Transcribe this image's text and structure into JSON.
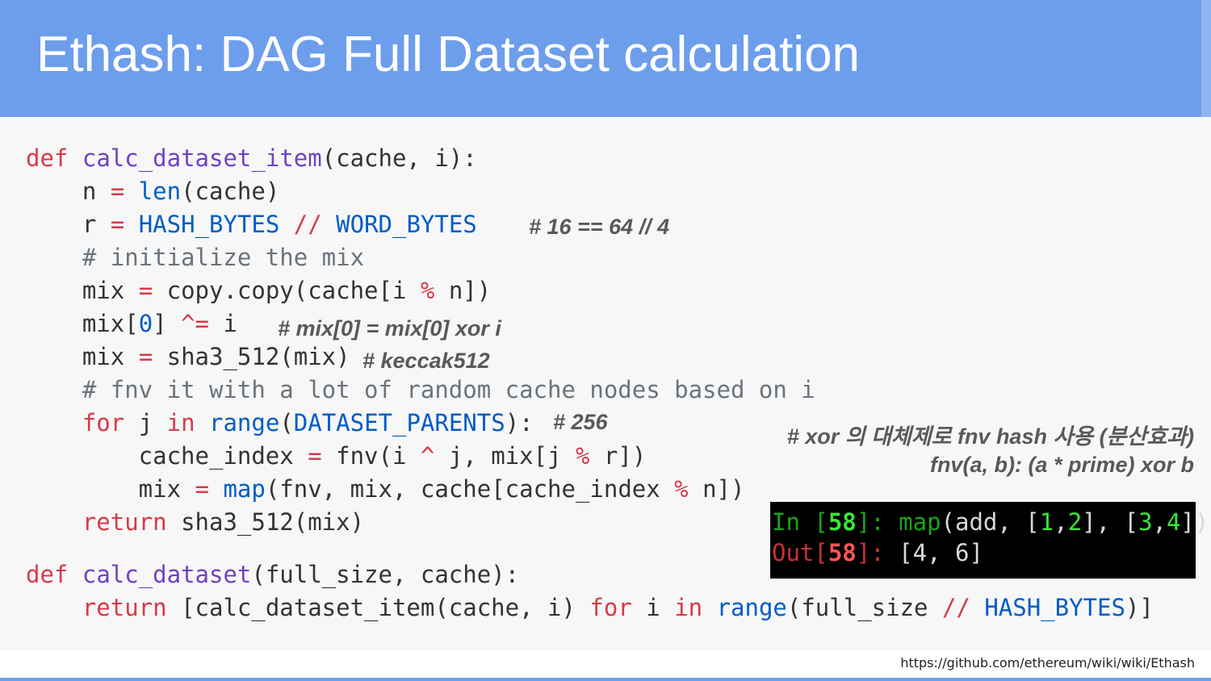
{
  "slide": {
    "title": "Ethash: DAG Full Dataset calculation",
    "source_url": "https://github.com/ethereum/wiki/wiki/Ethash"
  },
  "code": {
    "l1": [
      "def",
      " ",
      "calc_dataset_item",
      "(cache, i):"
    ],
    "l2": [
      "    n ",
      "=",
      " ",
      "len",
      "(cache)"
    ],
    "l3": [
      "    r ",
      "=",
      " ",
      "HASH_BYTES",
      " ",
      "//",
      " ",
      "WORD_BYTES"
    ],
    "l4": "    # initialize the mix",
    "l5": [
      "    mix ",
      "=",
      " copy.copy(cache[i ",
      "%",
      " n])"
    ],
    "l6": [
      "    mix[",
      "0",
      "] ",
      "^=",
      " i"
    ],
    "l7": [
      "    mix ",
      "=",
      " sha3_512(mix)"
    ],
    "l8": "    # fnv it with a lot of random cache nodes based on i",
    "l9": [
      "    ",
      "for",
      " j ",
      "in",
      " ",
      "range",
      "(",
      "DATASET_PARENTS",
      "):"
    ],
    "l10": [
      "        cache_index ",
      "=",
      " fnv(i ",
      "^",
      " j, mix[j ",
      "%",
      " r])"
    ],
    "l11": [
      "        mix ",
      "=",
      " ",
      "map",
      "(fnv, mix, cache[cache_index ",
      "%",
      " n])"
    ],
    "l12": [
      "    ",
      "return",
      " sha3_512(mix)"
    ],
    "l13": [
      "def",
      " ",
      "calc_dataset",
      "(full_size, cache):"
    ],
    "l14": [
      "    ",
      "return",
      " [calc_dataset_item(cache, i) ",
      "for",
      " i ",
      "in",
      " ",
      "range",
      "(full_size ",
      "//",
      " ",
      "HASH_BYTES",
      ")]"
    ]
  },
  "annotations": {
    "word_ratio": "# 16 == 64 // 4",
    "mix_xor": "# mix[0] = mix[0] xor i",
    "keccak": "# keccak512",
    "parents": "# 256",
    "fnv_note_line1": "# xor 의 대체제로 fnv hash 사용 (분산효과)",
    "fnv_note_line2": "fnv(a, b): (a * prime) xor b"
  },
  "terminal": {
    "in_prefix": "In [",
    "in_num": "58",
    "in_suffix": "]: ",
    "in_code": [
      "map",
      "(add, [",
      "1",
      ",",
      "2",
      "], [",
      "3",
      ",",
      "4",
      "])"
    ],
    "out_prefix": "Out[",
    "out_num": "58",
    "out_suffix": "]: ",
    "out_value": "[4, 6]"
  },
  "colors": {
    "header": "#6d9eeb",
    "keyword": "#d73a49",
    "function_name": "#6f42c1",
    "builtin": "#005cc5",
    "comment": "#6a737d",
    "terminal_bg": "#000000"
  }
}
